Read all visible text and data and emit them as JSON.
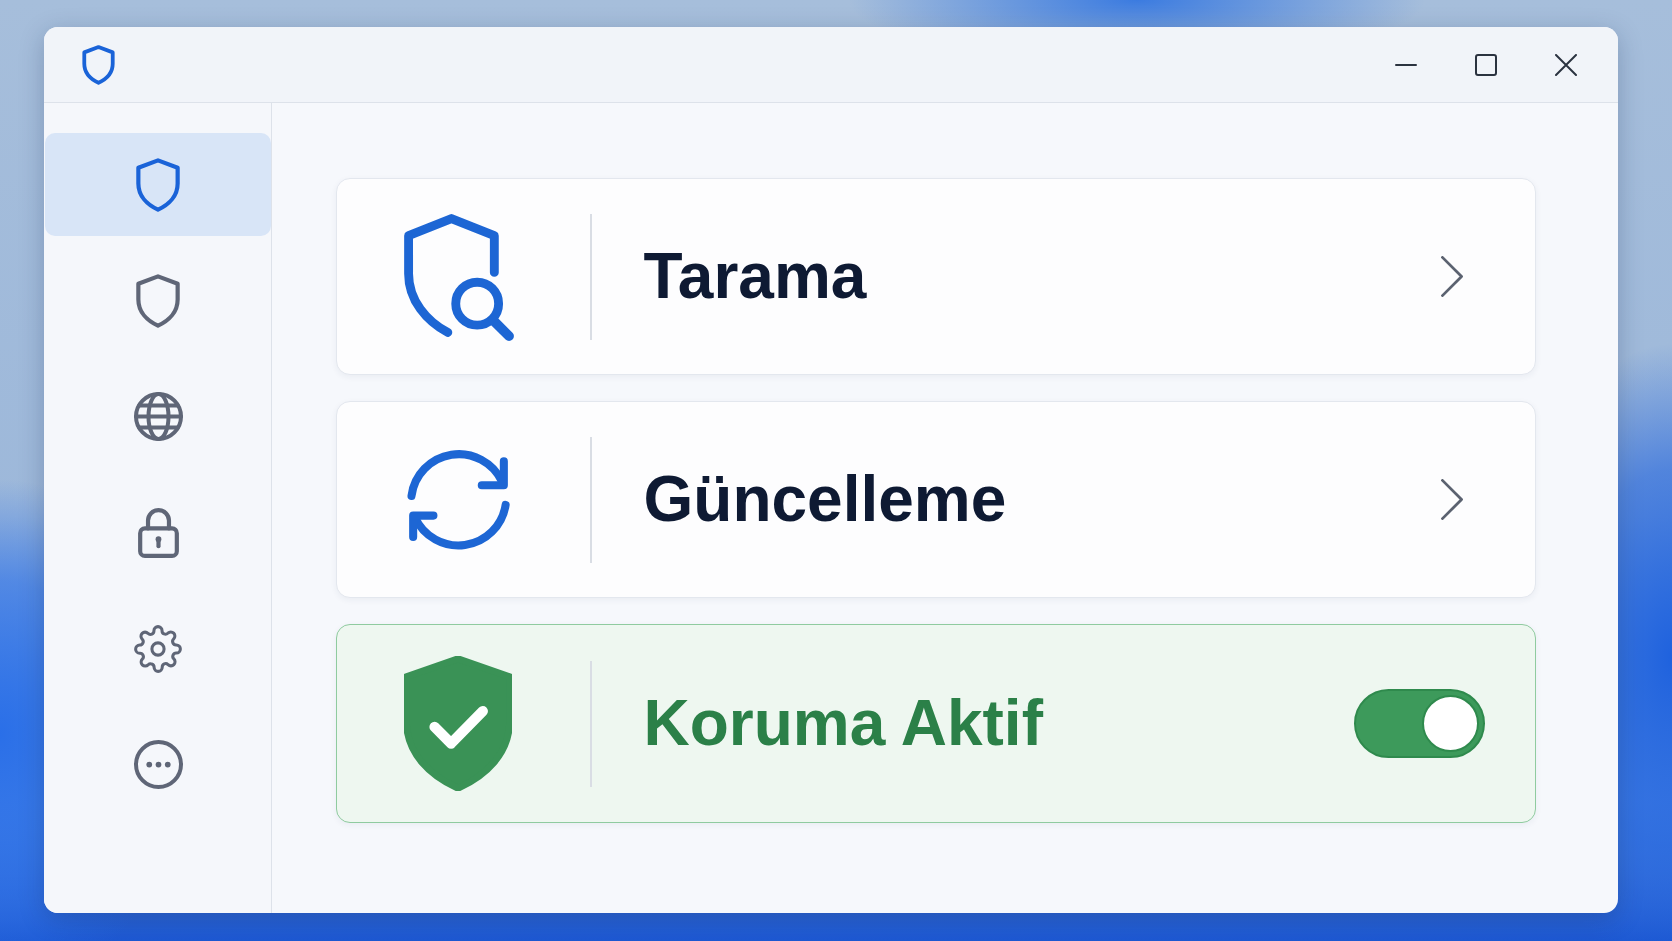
{
  "sidebar": {
    "items": [
      {
        "selected": true
      },
      {
        "selected": false
      },
      {
        "selected": false
      },
      {
        "selected": false
      },
      {
        "selected": false
      },
      {
        "selected": false
      }
    ]
  },
  "cards": [
    {
      "kind": "link",
      "label": "Tarama"
    },
    {
      "kind": "link",
      "label": "Güncelleme"
    },
    {
      "kind": "toggle",
      "label": "Koruma Aktif",
      "on": true
    }
  ]
}
